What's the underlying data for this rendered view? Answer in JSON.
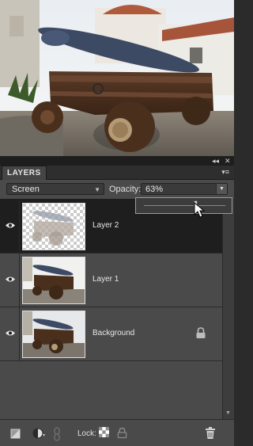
{
  "panel": {
    "title": "LAYERS",
    "collapse_icon": "double-arrow-left-icon",
    "close_icon": "close-icon",
    "menu_icon": "panel-menu-icon"
  },
  "toolbar": {
    "blend_mode": "Screen",
    "opacity_label": "Opacity:",
    "opacity_value": "63%",
    "opacity_fraction": 0.63
  },
  "layers": [
    {
      "name": "Layer 2",
      "selected": true,
      "visible": true,
      "locked": false
    },
    {
      "name": "Layer 1",
      "selected": false,
      "visible": true,
      "locked": false
    },
    {
      "name": "Background",
      "selected": false,
      "visible": true,
      "locked": true
    }
  ],
  "bottom": {
    "lock_label": "Lock:",
    "icons": [
      "new-layer-icon",
      "adjustment-layer-icon",
      "link-icon",
      "lock-transparent-icon",
      "lock-all-icon",
      "trash-icon"
    ]
  },
  "colors": {
    "panel_bg": "#4a4a4a",
    "selected_row": "#1e1e1e"
  }
}
